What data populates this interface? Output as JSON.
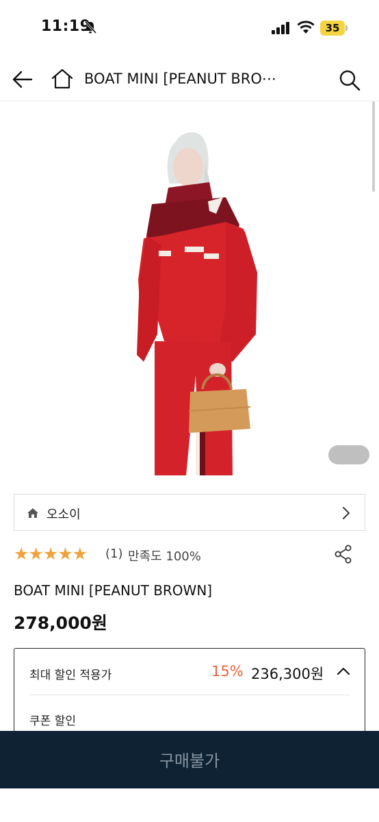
{
  "status_bar": {
    "time": "11:19",
    "battery": "35",
    "icons": [
      "bell-off-icon",
      "signal-icon",
      "wifi-icon",
      "battery-icon"
    ]
  },
  "header": {
    "title": "BOAT MINI [PEANUT BRO⋯",
    "icons": [
      "back-arrow-icon",
      "home-icon",
      "search-icon"
    ]
  },
  "brand": {
    "name": "오소이"
  },
  "rating": {
    "stars": "★★★★★",
    "star_value": 5,
    "review_count": "(1)",
    "satisfaction": "만족도 100%"
  },
  "product": {
    "title": "BOAT MINI [PEANUT BROWN]",
    "price": "278,000원"
  },
  "discount": {
    "label": "최대 할인 적용가",
    "rate": "15%",
    "price": "236,300원",
    "coupon_label": "쿠폰 할인"
  },
  "buy_button": {
    "label": "구매불가"
  },
  "colors": {
    "accent_orange": "#e8633a",
    "star": "#f0a23a",
    "buy_bar": "#0e2233"
  }
}
